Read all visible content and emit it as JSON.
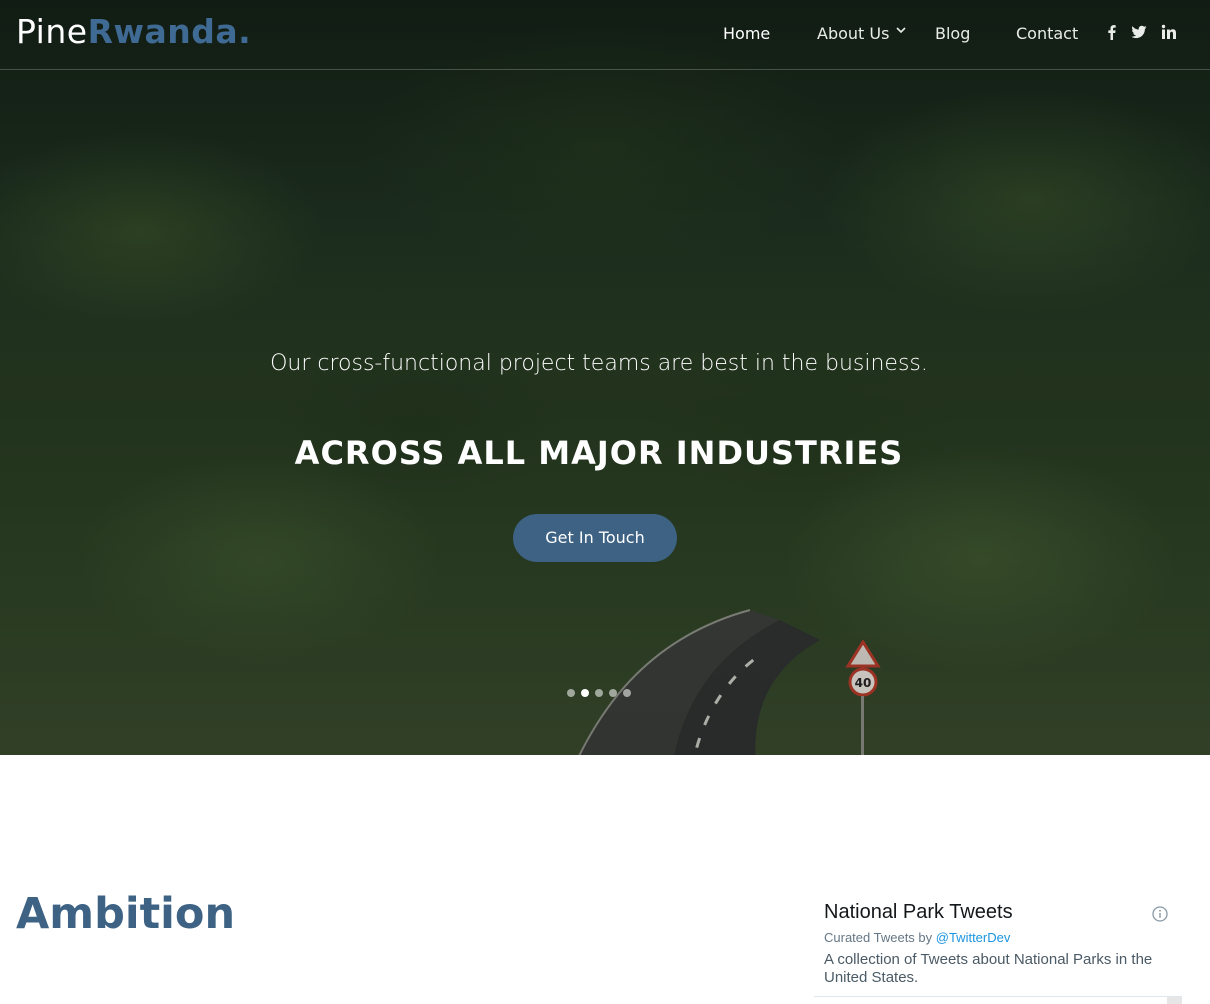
{
  "brand": {
    "part1": "Pine",
    "part2": "Rwanda",
    "part3": "."
  },
  "nav": {
    "items": [
      "Home",
      "About Us",
      "Blog",
      "Contact"
    ],
    "active": "Home"
  },
  "social": [
    "facebook-icon",
    "twitter-icon",
    "linkedin-icon"
  ],
  "hero": {
    "tagline": "Our cross-functional project teams are best in the business.",
    "headline": "ACROSS ALL MAJOR INDUSTRIES",
    "cta_label": "Get In Touch",
    "slides": 5,
    "active_slide": 2,
    "sign_text": "40"
  },
  "section": {
    "title": "Ambition"
  },
  "twitter": {
    "title": "National Park Tweets",
    "curated_prefix": "Curated Tweets by ",
    "handle": "@TwitterDev",
    "description": "A collection of Tweets about National Parks in the United States."
  },
  "colors": {
    "accent": "#3d6283",
    "logo_accent": "#3f6a93",
    "link": "#1b95e0"
  }
}
